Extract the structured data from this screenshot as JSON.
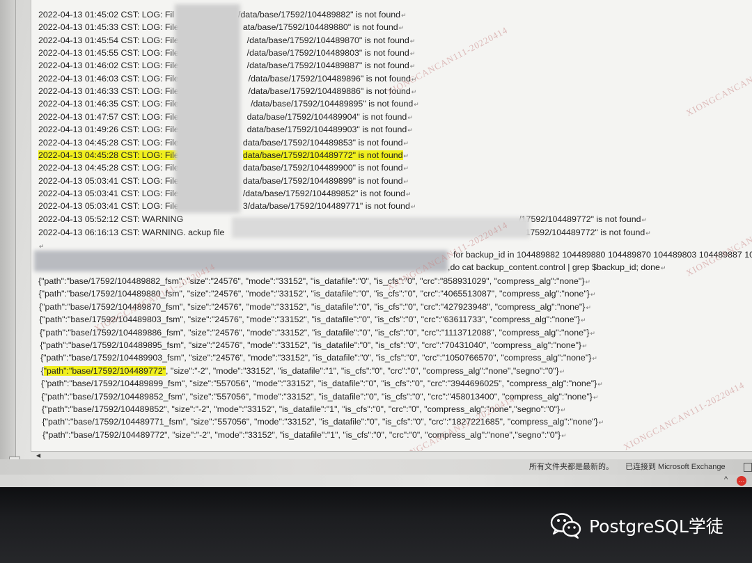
{
  "document": {
    "log_lines": [
      {
        "segments": [
          "2022-04-13 01:45:02 CST: LOG: Fil",
          "/data/base/17592/104489882\" is not found"
        ]
      },
      {
        "segments": [
          "2022-04-13 01:45:33 CST: LOG: File",
          "ata/base/17592/104489880\" is not found"
        ]
      },
      {
        "segments": [
          "2022-04-13 01:45:54 CST: LOG: File '",
          "/data/base/17592/104489870\" is not found"
        ]
      },
      {
        "segments": [
          "2022-04-13 01:45:55 CST: LOG: File '",
          "/data/base/17592/104489803\" is not found"
        ]
      },
      {
        "segments": [
          "2022-04-13 01:46:02 CST: LOG: File '",
          "/data/base/17592/104489887\" is not found"
        ]
      },
      {
        "segments": [
          "2022-04-13 01:46:03 CST: LOG: File \"",
          "/data/base/17592/104489896\" is not found"
        ]
      },
      {
        "segments": [
          "2022-04-13 01:46:33 CST: LOG: File \"",
          "/data/base/17592/104489886\" is not found"
        ]
      },
      {
        "segments": [
          "2022-04-13 01:46:35 CST: LOG: File \"/",
          "/data/base/17592/104489895\" is not found"
        ]
      },
      {
        "segments": [
          "2022-04-13 01:47:57 CST: LOG: File '",
          "data/base/17592/104489904\" is not found"
        ]
      },
      {
        "segments": [
          "2022-04-13 01:49:26 CST: LOG: File '",
          "data/base/17592/104489903\" is not found"
        ]
      },
      {
        "segments": [
          "2022-04-13 04:45:28 CST: LOG: File",
          "data/base/17592/104489853\" is not found"
        ]
      },
      {
        "segments": [
          "2022-04-13 04:45:28 CST: LOG: File",
          "data/base/17592/104489772\" is not found"
        ],
        "highlight": true
      },
      {
        "segments": [
          "2022-04-13 04:45:28 CST: LOG: File",
          "data/base/17592/104489900\" is not found"
        ]
      },
      {
        "segments": [
          "2022-04-13 05:03:41 CST: LOG: File",
          "data/base/17592/104489899\" is not found"
        ]
      },
      {
        "segments": [
          "2022-04-13 05:03:41 CST: LOG: File",
          "/data/base/17592/104489852\" is not found"
        ]
      },
      {
        "segments": [
          "2022-04-13 05:03:41 CST: LOG: File",
          "3/data/base/17592/104489771\" is not found"
        ]
      }
    ],
    "warning_lines": [
      {
        "left": "2022-04-13 05:52:12 CST: WARNING",
        "right": "/17592/104489772\" is not found"
      },
      {
        "left": "2022-04-13 06:16:13 CST: WARNING. ackup file",
        "right": "17592/104489772\" is not found"
      }
    ],
    "command_line_1": "for backup_id in 104489882 104489880 104489870 104489803 104489887 10",
    "command_line_2": ",do cat backup_content.control | grep $backup_id; done",
    "json_lines": [
      "{\"path\":\"base/17592/104489882_fsm\", \"size\":\"24576\", \"mode\":\"33152\", \"is_datafile\":\"0\", \"is_cfs\":\"0\", \"crc\":\"858931029\", \"compress_alg\":\"none\"}",
      "{\"path\":\"base/17592/104489880_fsm\", \"size\":\"24576\", \"mode\":\"33152\", \"is_datafile\":\"0\", \"is_cfs\":\"0\", \"crc\":\"4065513087\", \"compress_alg\":\"none\"}",
      "{\"path\":\"base/17592/104489870_fsm\", \"size\":\"24576\", \"mode\":\"33152\", \"is_datafile\":\"0\", \"is_cfs\":\"0\", \"crc\":\"427923948\", \"compress_alg\":\"none\"}",
      "{\"path\":\"base/17592/104489803_fsm\", \"size\":\"24576\", \"mode\":\"33152\", \"is_datafile\":\"0\", \"is_cfs\":\"0\", \"crc\":\"63611733\", \"compress_alg\":\"none\"}",
      "{\"path\":\"base/17592/104489886_fsm\", \"size\":\"24576\", \"mode\":\"33152\", \"is_datafile\":\"0\", \"is_cfs\":\"0\", \"crc\":\"1113712088\", \"compress_alg\":\"none\"}",
      "{\"path\":\"base/17592/104489895_fsm\", \"size\":\"24576\", \"mode\":\"33152\", \"is_datafile\":\"0\", \"is_cfs\":\"0\", \"crc\":\"70431040\", \"compress_alg\":\"none\"}",
      "{\"path\":\"base/17592/104489903_fsm\", \"size\":\"24576\", \"mode\":\"33152\", \"is_datafile\":\"0\", \"is_cfs\":\"0\", \"crc\":\"1050766570\", \"compress_alg\":\"none\"}",
      "",
      "{\"path\":\"base/17592/104489899_fsm\", \"size\":\"557056\", \"mode\":\"33152\", \"is_datafile\":\"0\", \"is_cfs\":\"0\", \"crc\":\"3944696025\", \"compress_alg\":\"none\"}",
      "{\"path\":\"base/17592/104489852_fsm\", \"size\":\"557056\", \"mode\":\"33152\", \"is_datafile\":\"0\", \"is_cfs\":\"0\", \"crc\":\"458013400\", \"compress_alg\":\"none\"}",
      "{\"path\":\"base/17592/104489852\", \"size\":\"-2\", \"mode\":\"33152\", \"is_datafile\":\"1\", \"is_cfs\":\"0\", \"crc\":\"0\", \"compress_alg\":\"none\",\"segno\":\"0\"}",
      "{\"path\":\"base/17592/104489771_fsm\", \"size\":\"557056\", \"mode\":\"33152\", \"is_datafile\":\"0\", \"is_cfs\":\"0\", \"crc\":\"1827221685\", \"compress_alg\":\"none\"}",
      "{\"path\":\"base/17592/104489772\", \"size\":\"-2\", \"mode\":\"33152\", \"is_datafile\":\"1\", \"is_cfs\":\"0\", \"crc\":\"0\", \"compress_alg\":\"none\",\"segno\":\"0\"}"
    ],
    "json_highlight_line": {
      "brace": "{",
      "highlighted": "\"path\":\"base/17592/104489772\"",
      "rest": ", \"size\":\"-2\", \"mode\":\"33152\", \"is_datafile\":\"1\", \"is_cfs\":\"0\", \"crc\":\"0\", \"compress_alg\":\"none\",\"segno\":\"0\"}"
    },
    "paragraph_mark": "↵",
    "watermark_text": "XIONGCANCAN111-20220414"
  },
  "statusbar": {
    "sync_status": "所有文件夹都是最新的。",
    "connection_status": "已连接到 Microsoft Exchange"
  },
  "tray": {
    "chevron": "^",
    "badge": "···"
  },
  "account": {
    "name": "PostgreSQL学徒",
    "logo_icon": "wechat-icon"
  },
  "colors": {
    "highlight": "#f0ef1e",
    "tray_badge": "#d9332b"
  }
}
